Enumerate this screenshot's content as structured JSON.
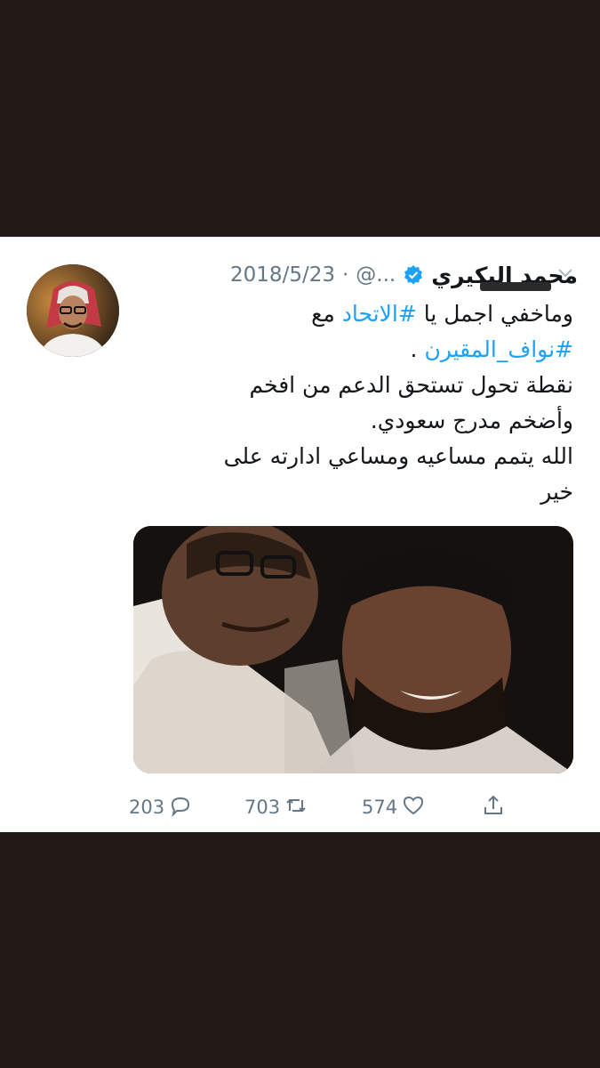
{
  "tweet": {
    "author_name": "محمد البكيري",
    "verified_icon": "verified-badge-icon",
    "handle": "@...",
    "separator": "·",
    "date": "2018/5/23",
    "text": {
      "line1_pre": "وماخفي اجمل يا ",
      "line1_tag": "#الاتحاد",
      "line1_post": " مع",
      "line2_tag": "#نواف_المقيرن",
      "line2_post": " .",
      "line3": "نقطة تحول تستحق الدعم من افخم",
      "line4": "وأضخم مدرج سعودي.",
      "line5": "الله يتمم مساعيه ومساعي ادارته على",
      "line6": "خير"
    },
    "accent_color": "#1da1f2",
    "actions": {
      "replies": "203",
      "retweets": "703",
      "likes": "574"
    },
    "icons": {
      "reply": "reply-icon",
      "retweet": "retweet-icon",
      "like": "heart-icon",
      "share": "share-icon",
      "caret": "chevron-down-icon"
    }
  }
}
